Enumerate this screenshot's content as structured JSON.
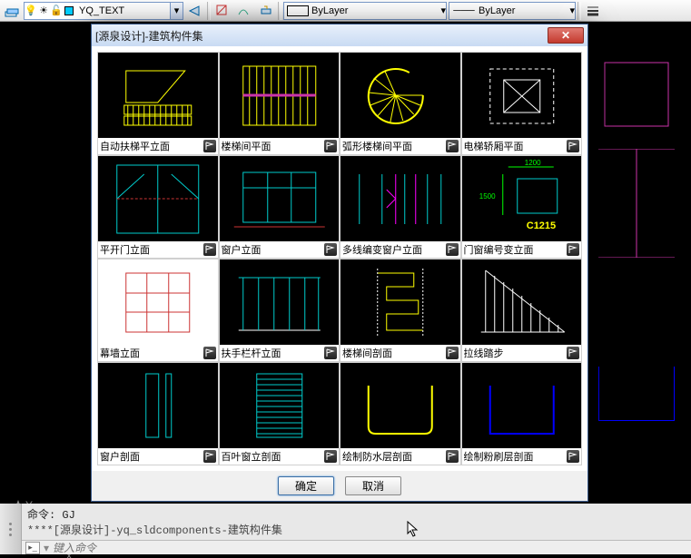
{
  "toolbar": {
    "layer_name": "YQ_TEXT",
    "bylayer1": "ByLayer",
    "bylayer2": "ByLayer"
  },
  "dialog": {
    "title": "[源泉设计]-建筑构件集",
    "ok": "确定",
    "cancel": "取消",
    "cells": [
      {
        "label": "自动扶梯平立面"
      },
      {
        "label": "楼梯间平面"
      },
      {
        "label": "弧形楼梯间平面"
      },
      {
        "label": "电梯轿厢平面"
      },
      {
        "label": "平开门立面"
      },
      {
        "label": "窗户立面"
      },
      {
        "label": "多线编变窗户立面"
      },
      {
        "label": "门窗编号变立面"
      },
      {
        "label": "幕墙立面"
      },
      {
        "label": "扶手栏杆立面"
      },
      {
        "label": "楼梯间剖面"
      },
      {
        "label": "拉线踏步"
      },
      {
        "label": "窗户剖面"
      },
      {
        "label": "百叶窗立剖面"
      },
      {
        "label": "绘制防水层剖面"
      },
      {
        "label": "绘制粉刷层剖面"
      }
    ]
  },
  "cmd": {
    "line1": "命令: GJ",
    "line2": "****[源泉设计]-yq_sldcomponents-建筑构件集",
    "placeholder": "键入命令"
  },
  "dims": {
    "w": "1200",
    "h": "1500",
    "code": "C1215"
  }
}
